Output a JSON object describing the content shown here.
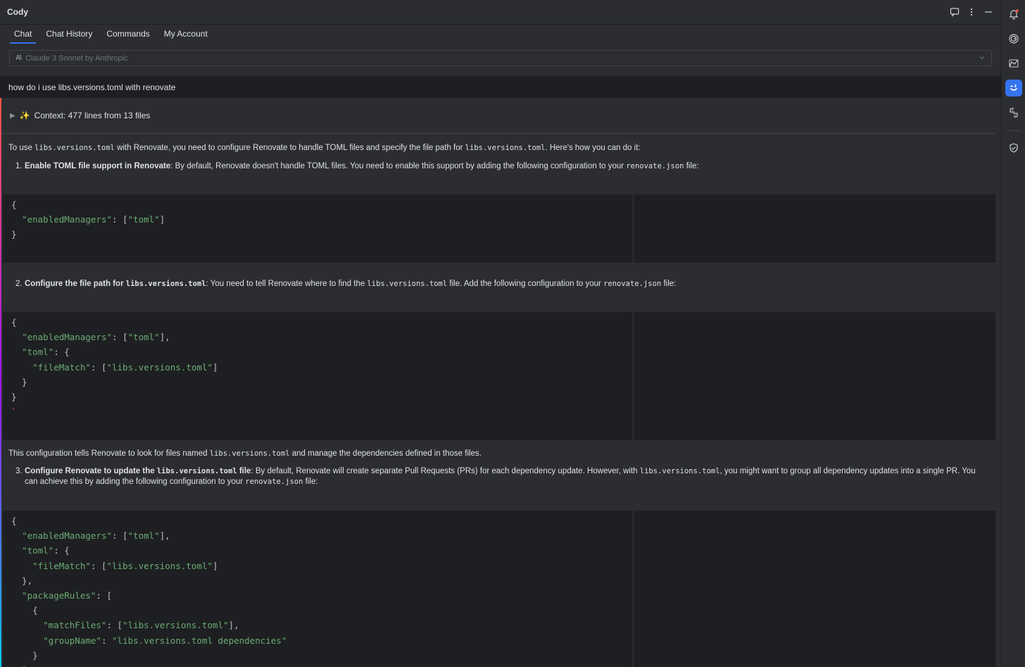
{
  "window": {
    "title": "Cody"
  },
  "titlebar_icons": [
    "chat-bubble-icon",
    "more-vertical-icon",
    "minimize-icon"
  ],
  "tabs": [
    {
      "label": "Chat",
      "active": true
    },
    {
      "label": "Chat History",
      "active": false
    },
    {
      "label": "Commands",
      "active": false
    },
    {
      "label": "My Account",
      "active": false
    }
  ],
  "model": {
    "logo": "A\\",
    "label": "Claude 3 Sonnet by Anthropic"
  },
  "question": "how do i use libs.versions.toml with renovate",
  "context": {
    "sparkle": "✨",
    "label": "Context: 477 lines from 13 files"
  },
  "answer": {
    "intro": {
      "t1": "To use ",
      "c1": "libs.versions.toml",
      "t2": " with Renovate, you need to configure Renovate to handle TOML files and specify the file path for ",
      "c2": "libs.versions.toml",
      "t3": ". Here's how you can do it:"
    },
    "step1": {
      "num": "1.",
      "bold": "Enable TOML file support in Renovate",
      "text": ": By default, Renovate doesn't handle TOML files. You need to enable this support by adding the following configuration to your ",
      "code": "renovate.json",
      "tail": " file:"
    },
    "code1": [
      "{",
      "  \"enabledManagers\": [\"toml\"]",
      "}"
    ],
    "step2": {
      "num": "2.",
      "bold": "Configure the file path for ",
      "bold_code": "libs.versions.toml",
      "text": ": You need to tell Renovate where to find the ",
      "code": "libs.versions.toml",
      "text2": " file. Add the following configuration to your ",
      "code2": "renovate.json",
      "tail": " file:"
    },
    "code2": [
      "{",
      "  \"enabledManagers\": [\"toml\"],",
      "  \"toml\": {",
      "    \"fileMatch\": [\"libs.versions.toml\"]",
      "  }",
      "}",
      "`"
    ],
    "note": {
      "t1": "This configuration tells Renovate to look for files named ",
      "c1": "libs.versions.toml",
      "t2": " and manage the dependencies defined in those files."
    },
    "step3": {
      "num": "3.",
      "bold": "Configure Renovate to update the ",
      "bold_code": "libs.versions.toml",
      "bold_tail": " file",
      "text": ": By default, Renovate will create separate Pull Requests (PRs) for each dependency update. However, with ",
      "code": "libs.versions.toml",
      "text2": ", you might want to group all dependency updates into a single PR. You can achieve this by adding the following configuration to your ",
      "code2": "renovate.json",
      "tail": " file:"
    },
    "code3": [
      "{",
      "  \"enabledManagers\": [\"toml\"],",
      "  \"toml\": {",
      "    \"fileMatch\": [\"libs.versions.toml\"]",
      "  },",
      "  \"packageRules\": [",
      "    {",
      "      \"matchFiles\": [\"libs.versions.toml\"],",
      "      \"groupName\": \"libs.versions.toml dependencies\"",
      "    }",
      "  ]"
    ]
  },
  "rightbar_icons": [
    "notifications-icon",
    "spiral-icon",
    "deploy-icon",
    "cody-icon",
    "python-icon",
    "shield-check-icon"
  ],
  "colors": {
    "accent": "#3574f0",
    "string": "#6aab73",
    "code_bg": "#1e1f22",
    "panel_bg": "#2b2d30"
  }
}
